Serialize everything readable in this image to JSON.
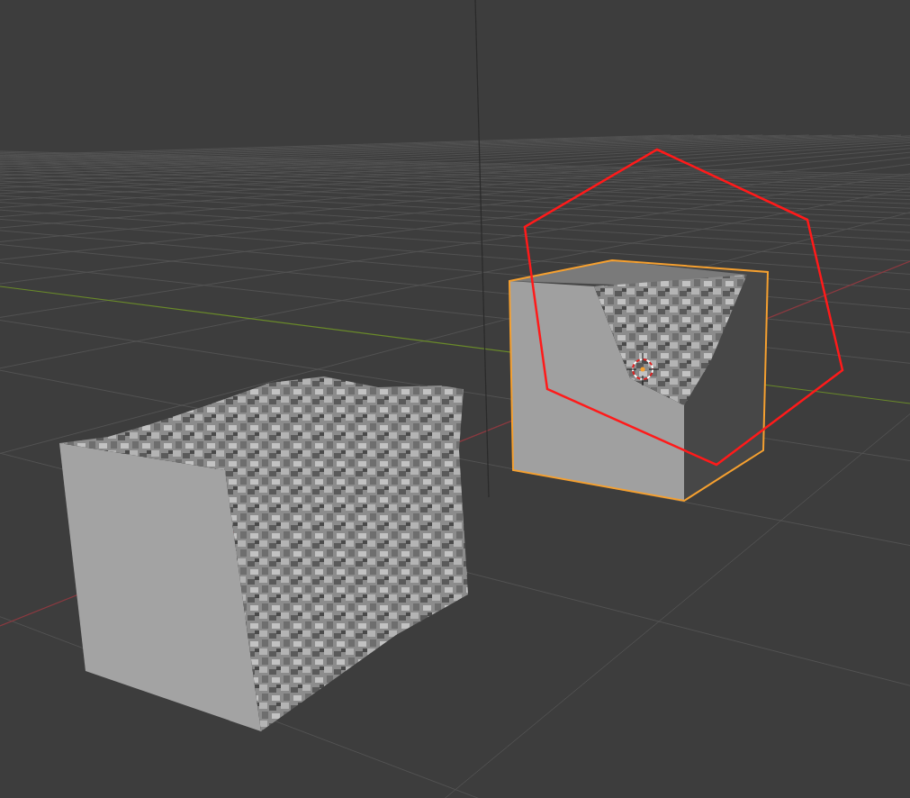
{
  "objects": [
    {
      "kind": "rough-cube",
      "selected": false
    },
    {
      "kind": "cut-cube",
      "selected": true
    }
  ]
}
